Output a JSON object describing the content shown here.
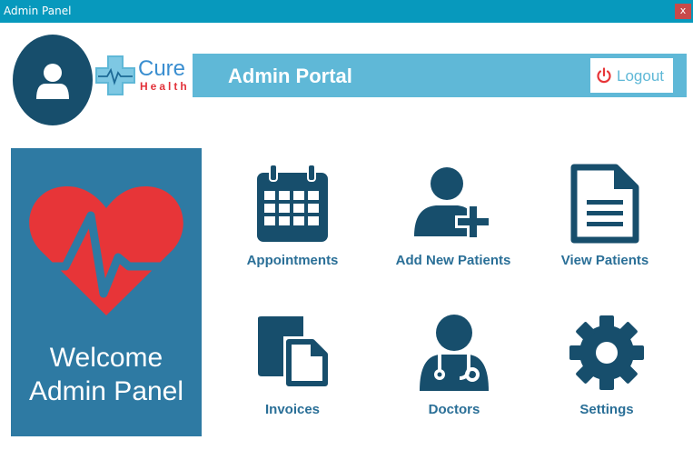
{
  "window": {
    "title": "Admin Panel",
    "close_label": "x"
  },
  "logo": {
    "word1": "Cure",
    "word2": "Health"
  },
  "header": {
    "title": "Admin Portal",
    "logout_label": "Logout"
  },
  "welcome": {
    "line1": "Welcome",
    "line2": "Admin Panel"
  },
  "menu": [
    {
      "label": "Appointments",
      "icon": "calendar-icon"
    },
    {
      "label": "Add New Patients",
      "icon": "add-user-icon"
    },
    {
      "label": "View Patients",
      "icon": "document-icon"
    },
    {
      "label": "Invoices",
      "icon": "invoices-icon"
    },
    {
      "label": "Doctors",
      "icon": "doctor-icon"
    },
    {
      "label": "Settings",
      "icon": "gear-icon"
    }
  ],
  "colors": {
    "titlebar": "#0799bd",
    "header": "#5fb8d7",
    "panel": "#2e7aa3",
    "icon": "#174e6c",
    "heart": "#e73538",
    "label": "#2a6f97"
  }
}
